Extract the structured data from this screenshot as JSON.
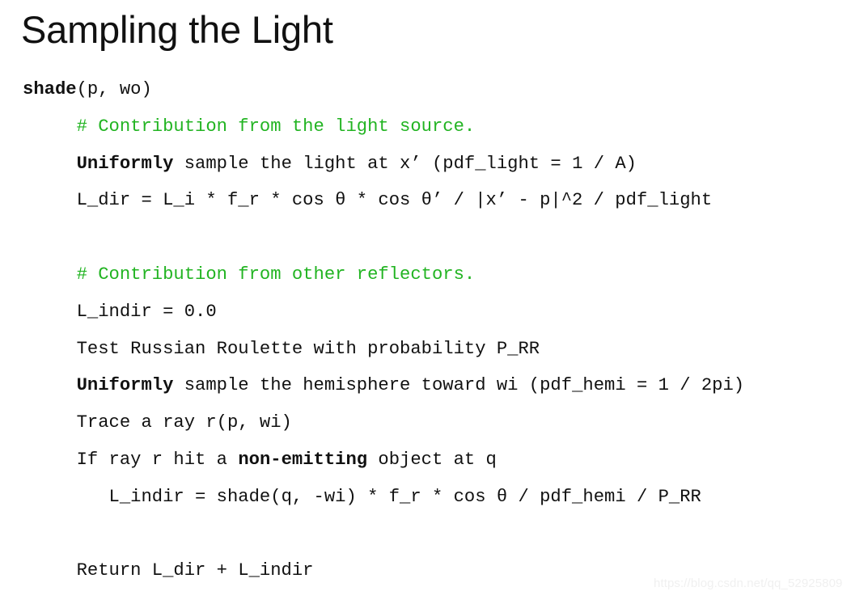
{
  "slide": {
    "title": "Sampling the Light",
    "background_color": "#ffffff",
    "text_color": "#111111",
    "comment_color": "#22b422"
  },
  "code": {
    "lines": [
      {
        "indent": 0,
        "tokens": [
          {
            "text": "shade",
            "style": "bold"
          },
          {
            "text": "(p, wo)",
            "style": "plain"
          }
        ]
      },
      {
        "indent": 5,
        "tokens": [
          {
            "text": "# Contribution from the light source.",
            "style": "comment"
          }
        ]
      },
      {
        "indent": 5,
        "tokens": [
          {
            "text": "Uniformly",
            "style": "bold"
          },
          {
            "text": " sample the light at x’ (pdf_light = 1 / A)",
            "style": "plain"
          }
        ]
      },
      {
        "indent": 5,
        "tokens": [
          {
            "text": "L_dir = L_i * f_r * cos θ * cos θ’ / |x’ - p|^2 / pdf_light",
            "style": "plain"
          }
        ]
      },
      {
        "indent": 0,
        "tokens": [
          {
            "text": "",
            "style": "blank"
          }
        ]
      },
      {
        "indent": 5,
        "tokens": [
          {
            "text": "# Contribution from other reflectors.",
            "style": "comment"
          }
        ]
      },
      {
        "indent": 5,
        "tokens": [
          {
            "text": "L_indir = 0.0",
            "style": "plain"
          }
        ]
      },
      {
        "indent": 5,
        "tokens": [
          {
            "text": "Test Russian Roulette with probability P_RR",
            "style": "plain"
          }
        ]
      },
      {
        "indent": 5,
        "tokens": [
          {
            "text": "Uniformly",
            "style": "bold"
          },
          {
            "text": " sample the hemisphere toward wi (pdf_hemi = 1 / 2pi)",
            "style": "plain"
          }
        ]
      },
      {
        "indent": 5,
        "tokens": [
          {
            "text": "Trace a ray r(p, wi)",
            "style": "plain"
          }
        ]
      },
      {
        "indent": 5,
        "tokens": [
          {
            "text": "If ray r hit a ",
            "style": "plain"
          },
          {
            "text": "non-emitting",
            "style": "bold"
          },
          {
            "text": " object at q",
            "style": "plain"
          }
        ]
      },
      {
        "indent": 8,
        "tokens": [
          {
            "text": "L_indir = shade(q, -wi) * f_r * cos θ / pdf_hemi / P_RR",
            "style": "plain"
          }
        ]
      },
      {
        "indent": 0,
        "tokens": [
          {
            "text": "",
            "style": "blank"
          }
        ]
      },
      {
        "indent": 5,
        "tokens": [
          {
            "text": "Return L_dir + L_indir",
            "style": "plain"
          }
        ]
      }
    ]
  },
  "watermark": {
    "text": "https://blog.csdn.net/qq_52925809"
  }
}
